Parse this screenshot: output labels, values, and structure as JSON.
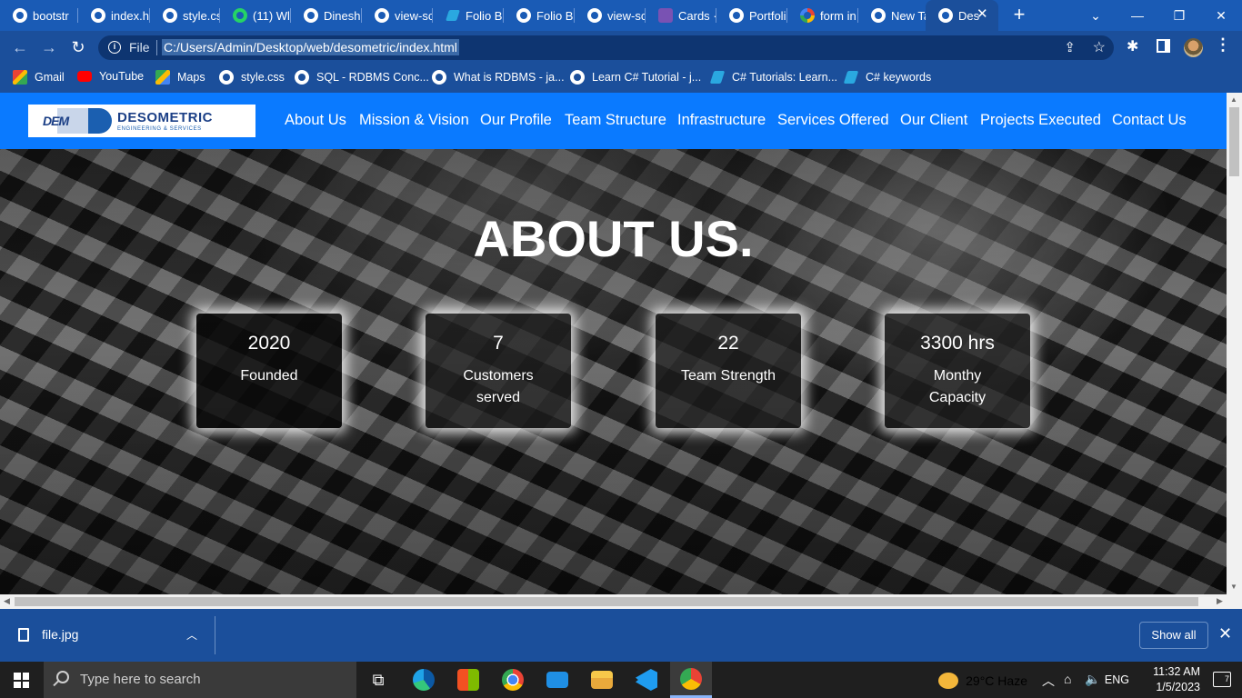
{
  "browser": {
    "tabs": [
      {
        "label": "bootstr",
        "icon": "globe-icon"
      },
      {
        "label": "index.h",
        "icon": "globe-icon"
      },
      {
        "label": "style.cs",
        "icon": "globe-icon"
      },
      {
        "label": "(11) Wl",
        "icon": "whatsapp-icon"
      },
      {
        "label": "Dinesh",
        "icon": "globe-icon"
      },
      {
        "label": "view-sc",
        "icon": "globe-icon"
      },
      {
        "label": "Folio B",
        "icon": "trello-icon"
      },
      {
        "label": "Folio B",
        "icon": "globe-icon"
      },
      {
        "label": "view-sc",
        "icon": "globe-icon"
      },
      {
        "label": "Cards ·",
        "icon": "bootstrap-icon"
      },
      {
        "label": "Portfoli",
        "icon": "globe-icon"
      },
      {
        "label": "form in",
        "icon": "google-icon"
      },
      {
        "label": "New Ta",
        "icon": "chrome-icon"
      },
      {
        "label": "Des",
        "icon": "globe-icon"
      }
    ],
    "close_glyph": "✕",
    "newtab_glyph": "+",
    "omnibox": {
      "scheme_label": "File",
      "url": "C:/Users/Admin/Desktop/web/desometric/index.html"
    },
    "bookmarks": [
      {
        "label": "Gmail",
        "icon": "gmail-icon"
      },
      {
        "label": "YouTube",
        "icon": "youtube-icon"
      },
      {
        "label": "Maps",
        "icon": "maps-icon"
      },
      {
        "label": "style.css",
        "icon": "globe-icon"
      },
      {
        "label": "SQL - RDBMS Conc...",
        "icon": "globe-icon"
      },
      {
        "label": "What is RDBMS - ja...",
        "icon": "globe-icon"
      },
      {
        "label": "Learn C# Tutorial - j...",
        "icon": "globe-icon"
      },
      {
        "label": "C# Tutorials: Learn...",
        "icon": "csharp-site-icon"
      },
      {
        "label": "C# keywords",
        "icon": "csharp-site-icon"
      }
    ]
  },
  "site": {
    "logo": {
      "mark": "DEM",
      "name": "DESOMETRIC",
      "tagline": "ENGINEERING & SERVICES"
    },
    "nav": [
      "About Us",
      "Mission & Vision",
      "Our Profile",
      "Team Structure",
      "Infrastructure",
      "Services Offered",
      "Our Client",
      "Projects Executed",
      "Contact Us"
    ],
    "hero_title": "ABOUT US.",
    "stats": [
      {
        "value": "2020",
        "label": "Founded"
      },
      {
        "value": "7",
        "label": "Customers served"
      },
      {
        "value": "22",
        "label": "Team Strength"
      },
      {
        "value": "3300 hrs",
        "label": "Monthy Capacity"
      }
    ],
    "accent": "#0a7aff"
  },
  "download_bar": {
    "file": "file.jpg",
    "show_all": "Show all"
  },
  "taskbar": {
    "search_placeholder": "Type here to search",
    "weather": "29°C  Haze",
    "language": "ENG",
    "time": "11:32 AM",
    "date": "1/5/2023",
    "notifications": "7"
  }
}
